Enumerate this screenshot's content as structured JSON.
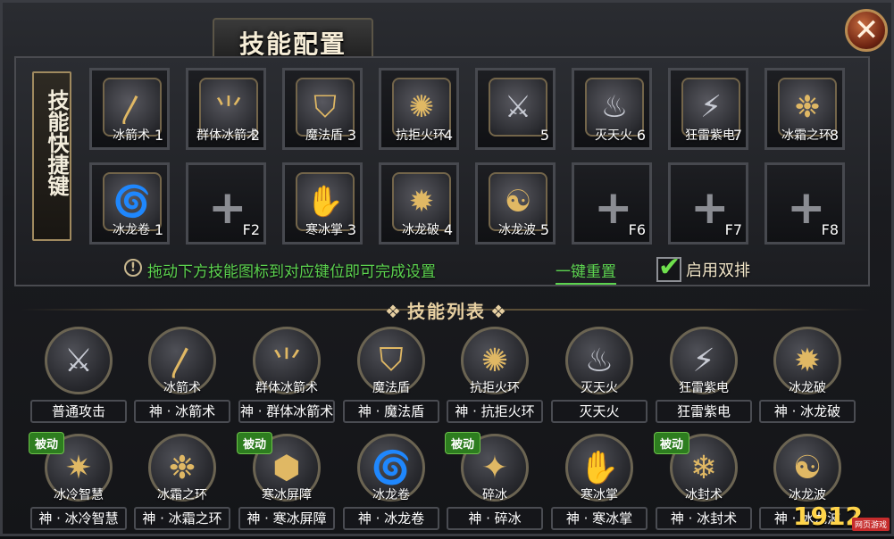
{
  "window": {
    "title": "技能配置",
    "close_glyph": "✕",
    "side_label": "技能快捷键",
    "hint_icon": "!",
    "hint": "拖动下方技能图标到对应键位即可完成设置",
    "reset": "一键重置",
    "dual_label": "启用双排",
    "dual_enabled": true,
    "section_title": "技能列表",
    "section_ornament_left": "❖",
    "section_ornament_right": "❖",
    "logo": "1912",
    "logo_tag": "网页游戏"
  },
  "colors": {
    "gold": "#e0b864",
    "green_text": "#5cd34f",
    "passive_badge": "#2d7d1f"
  },
  "hotbar_row1": [
    {
      "name": "冰箭术",
      "key": "1",
      "icon": "slash-icon"
    },
    {
      "name": "群体冰箭术",
      "key": "2",
      "icon": "multi-slash-icon"
    },
    {
      "name": "魔法盾",
      "key": "3",
      "icon": "shield-icon"
    },
    {
      "name": "抗拒火环",
      "key": "4",
      "icon": "ring-icon"
    },
    {
      "name": "",
      "key": "5",
      "icon": "sword-icon"
    },
    {
      "name": "灭天火",
      "key": "6",
      "icon": "flame-icon"
    },
    {
      "name": "狂雷紫电",
      "key": "7",
      "icon": "thunder-icon"
    },
    {
      "name": "冰霜之环",
      "key": "8",
      "icon": "frost-ring-icon"
    }
  ],
  "hotbar_row2": [
    {
      "name": "冰龙卷",
      "key": "1",
      "icon": "tornado-icon"
    },
    {
      "name": "",
      "key": "F2",
      "icon": "plus-icon"
    },
    {
      "name": "寒冰掌",
      "key": "3",
      "icon": "palm-icon"
    },
    {
      "name": "冰龙破",
      "key": "4",
      "icon": "burst-icon"
    },
    {
      "name": "冰龙波",
      "key": "5",
      "icon": "dragon-icon"
    },
    {
      "name": "",
      "key": "F6",
      "icon": "plus-icon"
    },
    {
      "name": "",
      "key": "F7",
      "icon": "plus-icon"
    },
    {
      "name": "",
      "key": "F8",
      "icon": "plus-icon"
    }
  ],
  "skills_row1": [
    {
      "name": "",
      "label": "普通攻击",
      "icon": "sword-icon",
      "passive": false
    },
    {
      "name": "冰箭术",
      "label": "神 · 冰箭术",
      "icon": "slash-icon",
      "passive": false
    },
    {
      "name": "群体冰箭术",
      "label": "神 · 群体冰箭术",
      "icon": "multi-slash-icon",
      "passive": false
    },
    {
      "name": "魔法盾",
      "label": "神 · 魔法盾",
      "icon": "shield-icon",
      "passive": false
    },
    {
      "name": "抗拒火环",
      "label": "神 · 抗拒火环",
      "icon": "ring-icon",
      "passive": false
    },
    {
      "name": "灭天火",
      "label": "灭天火",
      "icon": "flame-icon",
      "passive": false
    },
    {
      "name": "狂雷紫电",
      "label": "狂雷紫电",
      "icon": "thunder-icon",
      "passive": false
    },
    {
      "name": "冰龙破",
      "label": "神 · 冰龙破",
      "icon": "burst-icon",
      "passive": false
    }
  ],
  "skills_row2": [
    {
      "name": "冰冷智慧",
      "label": "神 · 冰冷智慧",
      "icon": "star-icon",
      "passive": true,
      "badge": "被动"
    },
    {
      "name": "冰霜之环",
      "label": "神 · 冰霜之环",
      "icon": "frost-ring-icon",
      "passive": false
    },
    {
      "name": "寒冰屏障",
      "label": "神 · 寒冰屏障",
      "icon": "barrier-icon",
      "passive": true,
      "badge": "被动"
    },
    {
      "name": "冰龙卷",
      "label": "神 · 冰龙卷",
      "icon": "tornado-icon",
      "passive": false
    },
    {
      "name": "碎冰",
      "label": "神 · 碎冰",
      "icon": "shard-icon",
      "passive": true,
      "badge": "被动"
    },
    {
      "name": "寒冰掌",
      "label": "神 · 寒冰掌",
      "icon": "palm-icon",
      "passive": false
    },
    {
      "name": "冰封术",
      "label": "神 · 冰封术",
      "icon": "freeze-icon",
      "passive": true,
      "badge": "被动"
    },
    {
      "name": "冰龙波",
      "label": "神 · 冰龙波",
      "icon": "dragon-icon",
      "passive": false
    }
  ]
}
